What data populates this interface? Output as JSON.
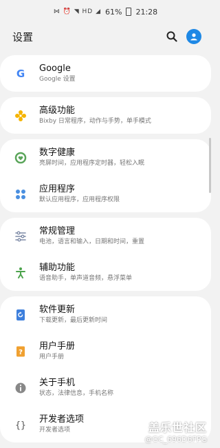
{
  "status": {
    "signal_icons": "⋈ ⏰ ◥ HD ◢",
    "battery": "61%",
    "time": "21:28"
  },
  "header": {
    "title": "设置"
  },
  "groups": [
    [
      {
        "title": "Google",
        "subtitle": "Google 设置",
        "icon": "google-icon",
        "color": "#4285f4"
      }
    ],
    [
      {
        "title": "高级功能",
        "subtitle": "Bixby 日常程序，动作与手势，单手模式",
        "icon": "advanced-features-icon",
        "color": "#f5b400"
      }
    ],
    [
      {
        "title": "数字健康",
        "subtitle": "亮屏时间，应用程序定时器，轻松入眠",
        "icon": "digital-wellbeing-icon",
        "color": "#5aa55a"
      },
      {
        "title": "应用程序",
        "subtitle": "默认应用程序，应用程序权限",
        "icon": "apps-icon",
        "color": "#4a8fe0"
      }
    ],
    [
      {
        "title": "常规管理",
        "subtitle": "电池，语言和输入，日期和时间，重置",
        "icon": "general-management-icon",
        "color": "#7d8aa6"
      },
      {
        "title": "辅助功能",
        "subtitle": "语音助手，单声道音频，悬浮菜单",
        "icon": "accessibility-icon",
        "color": "#4ca34c"
      }
    ],
    [
      {
        "title": "软件更新",
        "subtitle": "下载更新，最后更新时间",
        "icon": "software-update-icon",
        "color": "#3d7fdc"
      },
      {
        "title": "用户手册",
        "subtitle": "用户手册",
        "icon": "user-manual-icon",
        "color": "#f0a030"
      },
      {
        "title": "关于手机",
        "subtitle": "状态，法律信息，手机名称",
        "icon": "about-phone-icon",
        "color": "#888888"
      },
      {
        "title": "开发者选项",
        "subtitle": "开发者选项",
        "icon": "developer-options-icon",
        "color": "#555555"
      }
    ]
  ],
  "watermark": {
    "line1": "盖乐世社区",
    "line2": "@GC_696D6FPG"
  }
}
